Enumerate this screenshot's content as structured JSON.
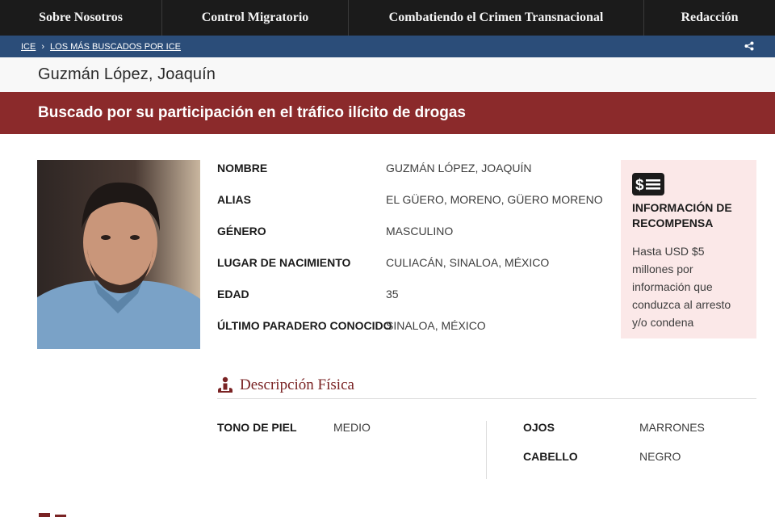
{
  "nav": {
    "items": [
      {
        "label": "Sobre Nosotros"
      },
      {
        "label": "Control Migratorio"
      },
      {
        "label": "Combatiendo el Crimen Transnacional"
      },
      {
        "label": "Redacción"
      }
    ]
  },
  "breadcrumb": {
    "items": [
      {
        "label": "ICE"
      },
      {
        "label": "LOS MÁS BUSCADOS POR ICE"
      }
    ],
    "separator": "›",
    "share_icon": "share-icon"
  },
  "profile": {
    "name": "Guzmán López, Joaquín",
    "banner": "Buscado por su participación en el tráfico ilícito de drogas"
  },
  "details": [
    {
      "label": "NOMBRE",
      "value": "GUZMÁN LÓPEZ, JOAQUÍN"
    },
    {
      "label": "ALIAS",
      "value": "EL GÜERO, MORENO, GÜERO MORENO"
    },
    {
      "label": "GÉNERO",
      "value": "MASCULINO"
    },
    {
      "label": "LUGAR DE NACIMIENTO",
      "value": "CULIACÁN, SINALOA, MÉXICO"
    },
    {
      "label": "EDAD",
      "value": "35"
    },
    {
      "label": "ÚLTIMO PARADERO CONOCIDO",
      "value": "SINALOA, MÉXICO"
    }
  ],
  "reward": {
    "icon": "money-icon",
    "title": "INFORMACIÓN DE RECOMPENSA",
    "text": "Hasta USD $5 millones por información que conduzca al arresto y/o condena"
  },
  "physical": {
    "title": "Descripción Física",
    "icon": "person-icon",
    "left": [
      {
        "label": "TONO DE PIEL",
        "value": "MEDIO"
      }
    ],
    "right": [
      {
        "label": "OJOS",
        "value": "MARRONES"
      },
      {
        "label": "CABELLO",
        "value": "NEGRO"
      }
    ]
  },
  "colors": {
    "nav_bg": "#1b1b1b",
    "breadcrumb_bg": "#2b4d79",
    "banner_bg": "#8b2a2b",
    "reward_bg": "#fbe8e8",
    "section_title": "#7a2324"
  }
}
